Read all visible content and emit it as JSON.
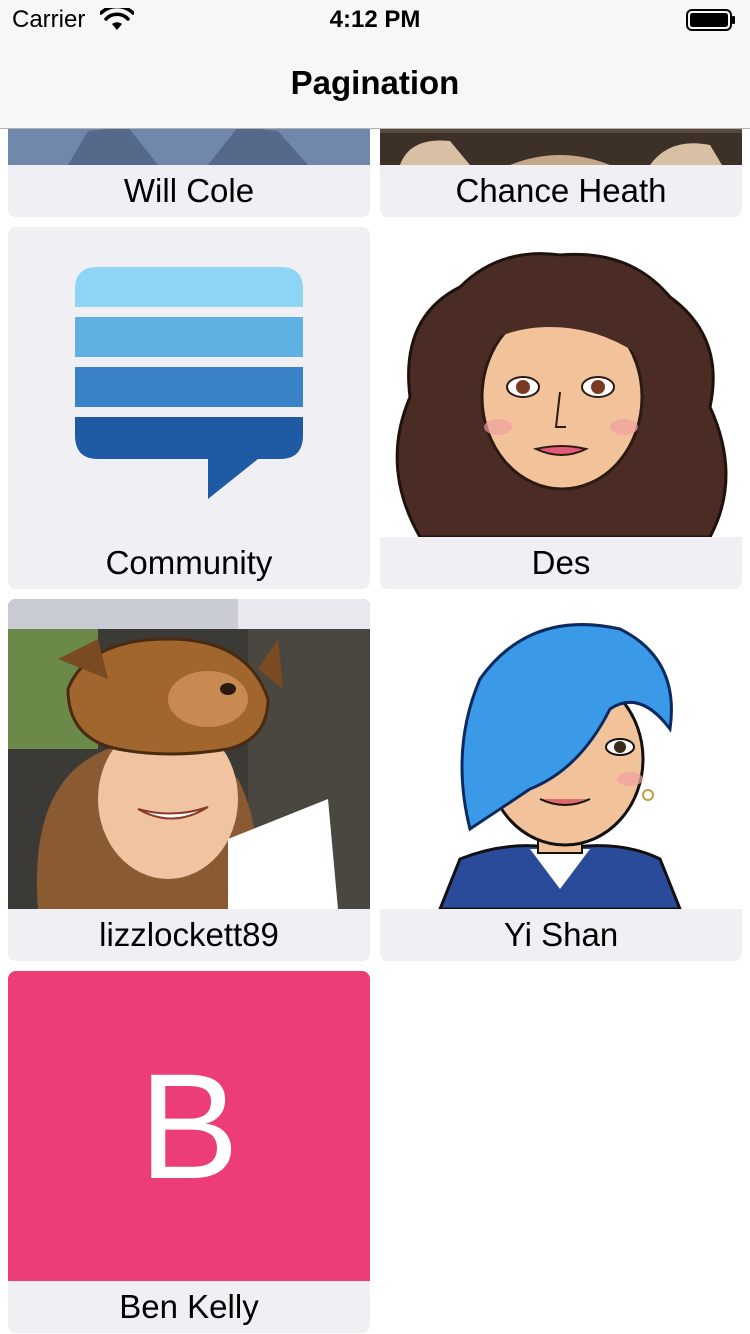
{
  "status_bar": {
    "carrier": "Carrier",
    "time": "4:12 PM"
  },
  "nav": {
    "title": "Pagination"
  },
  "cells": [
    {
      "name": "Will Cole",
      "avatar": "photo-man-icon"
    },
    {
      "name": "Chance Heath",
      "avatar": "photo-man-icon"
    },
    {
      "name": "Community",
      "avatar": "community-chat-icon"
    },
    {
      "name": "Des",
      "avatar": "bitmoji-curly-hair-icon"
    },
    {
      "name": "lizzlockett89",
      "avatar": "photo-woman-moose-hat-icon"
    },
    {
      "name": "Yi Shan",
      "avatar": "bitmoji-blue-hair-icon"
    },
    {
      "name": "Ben Kelly",
      "avatar": "letter-avatar-icon",
      "initial": "B",
      "color": "#ec3d76"
    }
  ],
  "colors": {
    "cell_bg": "#efeff4",
    "bar_bg": "#f7f7f7"
  }
}
